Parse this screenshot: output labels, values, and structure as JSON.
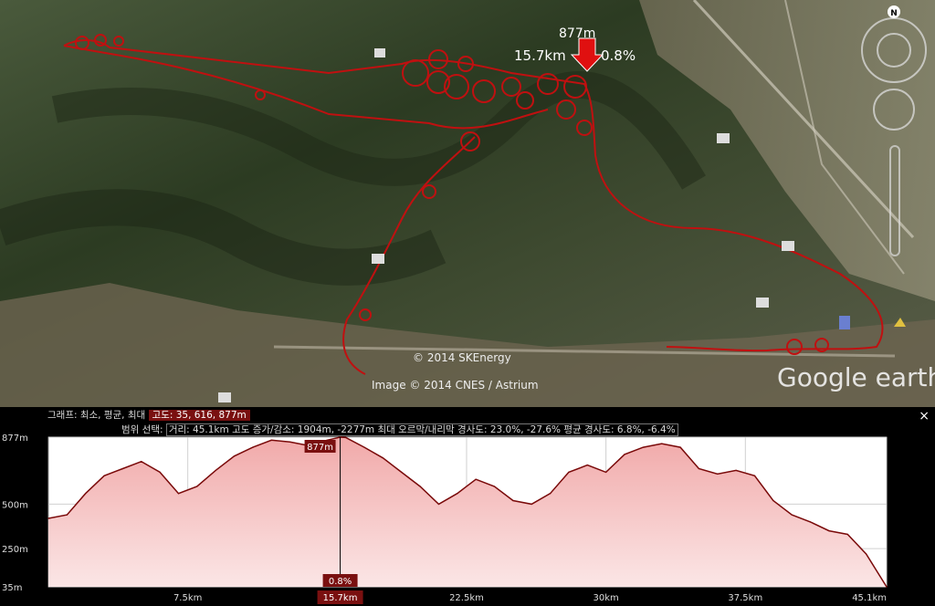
{
  "map": {
    "compass_label": "N",
    "tooltip": {
      "elevation": "877m",
      "distance": "15.7km",
      "slope": "0.8%"
    },
    "attribution_1": "© 2014 SKEnergy",
    "attribution_2": "Image © 2014 CNES / Astrium",
    "logo_text": "Google earth",
    "icons": [
      "museum-icon",
      "museum-icon",
      "museum-icon",
      "museum-icon",
      "museum-icon",
      "museum-icon",
      "gas-station-icon",
      "park-icon"
    ]
  },
  "panel": {
    "graph_label": "그래프: 최소, 평균, 최대",
    "graph_values": "고도: 35, 616, 877m",
    "range_label": "범위 선택:",
    "range_values": "거리: 45.1km  고도 증가/감소: 1904m, -2277m  최대 오르막/내리막 경사도: 23.0%, -27.6%  평균 경사도: 6.8%, -6.4%",
    "close_label": "×"
  },
  "chart_data": {
    "type": "area",
    "title": "",
    "xlabel": "",
    "ylabel": "",
    "xlim": [
      0,
      45.1
    ],
    "x_ticks": [
      7.5,
      15.7,
      22.5,
      30,
      37.5,
      45.1
    ],
    "x_tick_labels": [
      "7.5km",
      "15.7km",
      "22.5km",
      "30km",
      "37.5km",
      "45.1km"
    ],
    "y_ticks": [
      35,
      250,
      500,
      877
    ],
    "y_tick_labels": [
      "35m",
      "250m",
      "500m",
      "877m"
    ],
    "ylim": [
      35,
      877
    ],
    "grid": true,
    "cursor": {
      "x": 15.7,
      "elevation_label": "877m",
      "slope_label": "0.8%",
      "distance_label": "15.7km"
    },
    "series": [
      {
        "x": [
          0,
          1,
          2,
          3,
          4,
          5,
          6,
          7,
          8,
          9,
          10,
          11,
          12,
          13,
          14,
          15,
          15.7,
          16,
          17,
          18,
          19,
          20,
          21,
          22,
          23,
          24,
          25,
          26,
          27,
          28,
          29,
          30,
          31,
          32,
          33,
          34,
          35,
          36,
          37,
          38,
          39,
          40,
          41,
          42,
          43,
          44,
          45.1
        ],
        "y": [
          420,
          440,
          560,
          660,
          700,
          740,
          680,
          560,
          600,
          690,
          770,
          820,
          860,
          850,
          830,
          860,
          877,
          875,
          820,
          760,
          680,
          600,
          500,
          560,
          640,
          600,
          520,
          500,
          560,
          680,
          720,
          680,
          780,
          820,
          840,
          820,
          700,
          670,
          690,
          660,
          520,
          440,
          400,
          350,
          330,
          220,
          35
        ]
      }
    ]
  }
}
